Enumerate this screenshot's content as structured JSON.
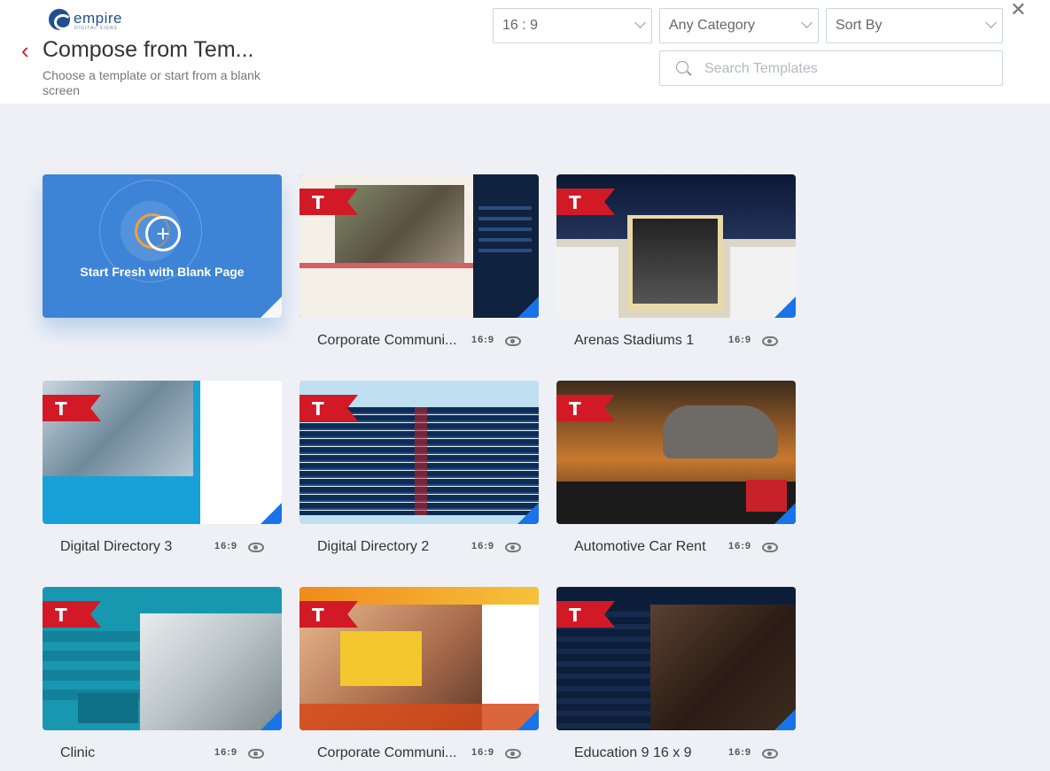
{
  "header": {
    "logo_word": "empire",
    "logo_tag": "DIGITAL SIGNS",
    "title": "Compose from Tem...",
    "subtitle": "Choose a template or start from a blank screen"
  },
  "filters": {
    "ratio": "16 : 9",
    "category": "Any Category",
    "sort": "Sort By",
    "search_placeholder": "Search Templates"
  },
  "blank": {
    "label": "Start Fresh with Blank Page"
  },
  "ribbon_letter": "T",
  "templates": [
    {
      "name": "Corporate Communi...",
      "ratio": "16:9"
    },
    {
      "name": "Arenas Stadiums 1",
      "ratio": "16:9"
    },
    {
      "name": "Digital Directory 3",
      "ratio": "16:9"
    },
    {
      "name": "Digital Directory 2",
      "ratio": "16:9"
    },
    {
      "name": "Automotive Car Rent",
      "ratio": "16:9"
    },
    {
      "name": "Clinic",
      "ratio": "16:9"
    },
    {
      "name": "Corporate Communi...",
      "ratio": "16:9"
    },
    {
      "name": "Education 9 16 x 9",
      "ratio": "16:9"
    }
  ]
}
